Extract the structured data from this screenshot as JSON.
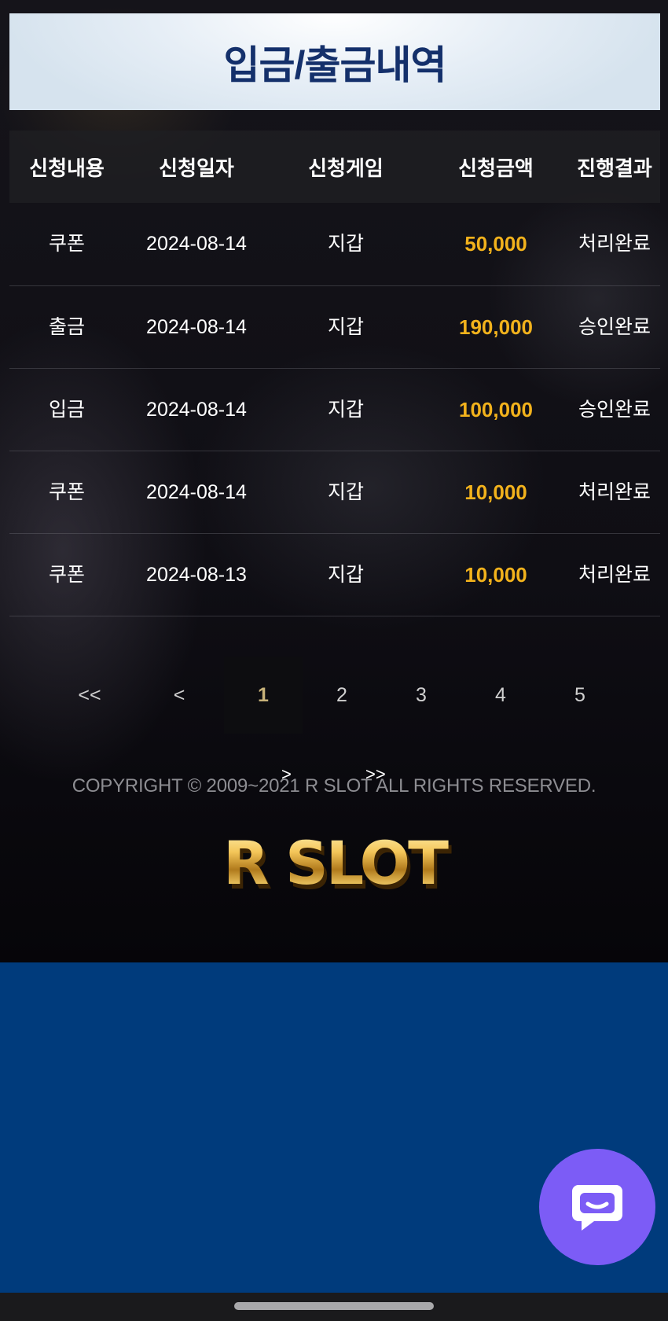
{
  "header": {
    "title": "입금/출금내역"
  },
  "table": {
    "columns": [
      "신청내용",
      "신청일자",
      "신청게임",
      "신청금액",
      "진행결과"
    ],
    "rows": [
      {
        "type": "쿠폰",
        "date": "2024-08-14",
        "game": "지갑",
        "amount": "50,000",
        "status": "처리완료"
      },
      {
        "type": "출금",
        "date": "2024-08-14",
        "game": "지갑",
        "amount": "190,000",
        "status": "승인완료"
      },
      {
        "type": "입금",
        "date": "2024-08-14",
        "game": "지갑",
        "amount": "100,000",
        "status": "승인완료"
      },
      {
        "type": "쿠폰",
        "date": "2024-08-14",
        "game": "지갑",
        "amount": "10,000",
        "status": "처리완료"
      },
      {
        "type": "쿠폰",
        "date": "2024-08-13",
        "game": "지갑",
        "amount": "10,000",
        "status": "처리완료"
      }
    ]
  },
  "pagination": {
    "first": "<<",
    "prev": "<",
    "pages": [
      "1",
      "2",
      "3",
      "4",
      "5"
    ],
    "current": "1",
    "next": ">",
    "last": ">>"
  },
  "footer": {
    "copyright": "COPYRIGHT © 2009~2021 R SLOT ALL RIGHTS RESERVED.",
    "logo_text": "R SLOT"
  },
  "colors": {
    "amount": "#f2b21c",
    "title": "#14306b",
    "lower_background": "#003b7c",
    "chat_button": "#7c5cf6"
  },
  "icons": {
    "chat": "chat-bubble-icon"
  }
}
